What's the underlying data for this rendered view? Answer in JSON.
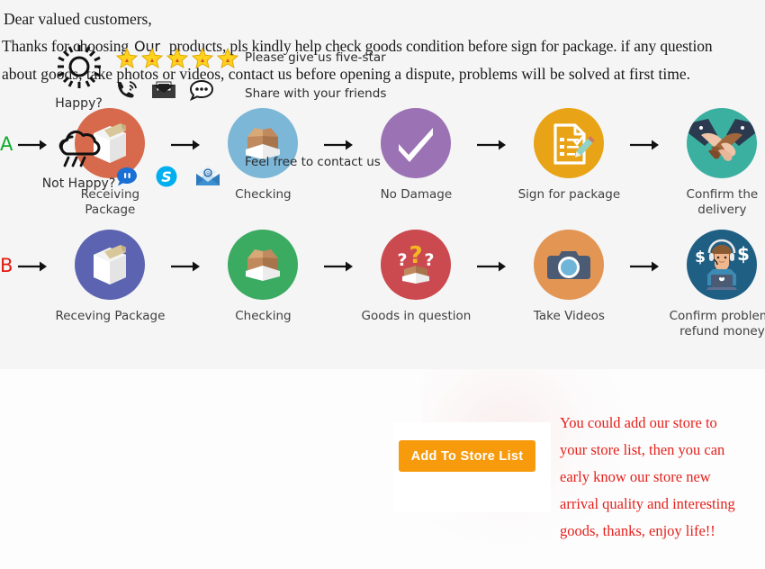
{
  "intro": {
    "line1": "Dear valued customers,",
    "line2_pre": "Thanks for choosing",
    "line2_our": "Our",
    "line2_post": "products, pls kindly help check goods condition before sign for package. if any question",
    "line3": "about goods, take photos or videos, contact us before opening a dispute, problems will be solved at first time."
  },
  "flow": {
    "row_a": {
      "letter": "A",
      "letter_color": "#0eab2a",
      "steps": [
        {
          "label": "Receiving Package",
          "icon": "package-box-icon",
          "circle_color": "#d7694c"
        },
        {
          "label": "Checking",
          "icon": "open-box-icon",
          "circle_color": "#7cb7d8"
        },
        {
          "label": "No Damage",
          "icon": "checkmark-icon",
          "circle_color": "#9b73b5"
        },
        {
          "label": "Sign for package",
          "icon": "signed-document-icon",
          "circle_color": "#e8a317"
        },
        {
          "label": "Confirm the delivery",
          "icon": "handshake-icon",
          "circle_color": "#3bb0a0"
        }
      ]
    },
    "row_b": {
      "letter": "B",
      "letter_color": "#e01a10",
      "steps": [
        {
          "label": "Receving Package",
          "icon": "package-box-icon",
          "circle_color": "#5c63b0"
        },
        {
          "label": "Checking",
          "icon": "open-box-icon",
          "circle_color": "#3cab62"
        },
        {
          "label": "Goods in question",
          "icon": "question-box-icon",
          "circle_color": "#cb4a4f"
        },
        {
          "label": "Take Videos",
          "icon": "camera-icon",
          "circle_color": "#e39553"
        },
        {
          "label": "Confirm problem,\nrefund money",
          "icon": "support-agent-icon",
          "circle_color": "#1f5f84"
        }
      ]
    },
    "arrow_icon": "right-arrow-icon"
  },
  "feedback": {
    "happy": {
      "label": "Happy?",
      "icon": "sun-icon"
    },
    "not_happy": {
      "label": "Not Happy?",
      "icon": "rain-cloud-icon"
    },
    "star_count": 5,
    "star_icon": "star-icon",
    "share_icons": [
      "phone-icon",
      "email-icon",
      "chat-bubble-icon"
    ],
    "im_icons": [
      "aliwangwang-icon",
      "skype-icon",
      "mail-envelope-icon"
    ],
    "text_five_star": "Please give us five-star",
    "text_share": "Share with your friends",
    "text_contact": "Feel free to contact us"
  },
  "store": {
    "button_label": "Add To Store List",
    "button_color": "#f79a0b",
    "promo_color": "#e4211c",
    "promo_lines": [
      "You could add our store to",
      "your store list, then you can",
      "early know our store new",
      "arrival quality and interesting",
      "goods, thanks, enjoy life!!"
    ]
  }
}
